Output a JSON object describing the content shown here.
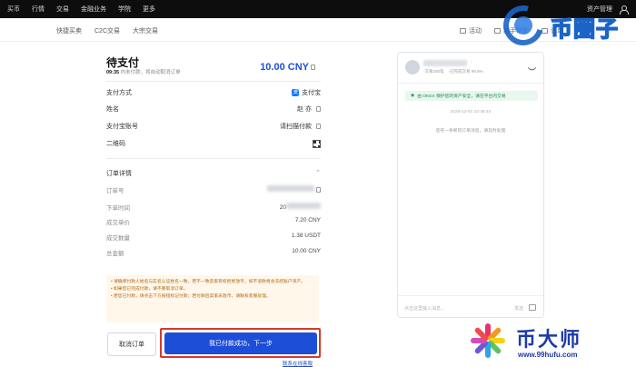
{
  "topnav": {
    "items": [
      "买币",
      "行情",
      "交易",
      "金融业务",
      "学院",
      "更多"
    ],
    "right_label": "资产管理"
  },
  "subnav": {
    "left": [
      "快捷买卖",
      "C2C交易",
      "大宗交易"
    ],
    "right": [
      "活动",
      "新手帮助",
      "订单"
    ]
  },
  "watermark_top": {
    "text": "币圈子",
    "color": "#1a64c8"
  },
  "order": {
    "status_title": "待支付",
    "countdown": "09:35",
    "countdown_suffix": "内未付款，将自动取消订单",
    "amount": "10.00 CNY",
    "rows": [
      {
        "label": "支付方式",
        "value": "支付宝"
      },
      {
        "label": "姓名",
        "value": "赵 亦"
      },
      {
        "label": "支付宝账号",
        "value": "请扫描付款"
      },
      {
        "label": "二维码",
        "value": ""
      }
    ],
    "details_title": "订单详情",
    "details": [
      {
        "label": "订单号",
        "value": ""
      },
      {
        "label": "下单时间",
        "value": "20"
      },
      {
        "label": "成交单价",
        "value": "7.20 CNY"
      },
      {
        "label": "成交数量",
        "value": "1.38 USDT"
      },
      {
        "label": "总金额",
        "value": "10.00 CNY"
      }
    ]
  },
  "notice": {
    "lines": [
      "• 请确保付款人姓名与实名认证姓名一致，若不一致卖家有权拒绝放币，如不退款将会冻结账户资产。",
      "• 如果您已完成付款，请不要取消订单。",
      "• 若您已付款，请点击下方按钮标记付款；若付款后卖家未放币，请联系客服处理。"
    ]
  },
  "buttons": {
    "cancel": "取消订单",
    "confirm": "我已付款成功，下一步",
    "contact": "联系在线客服"
  },
  "chat": {
    "nick_suffix": "·",
    "meta": [
      "·交易200笔",
      "·已完成交易 99.6%"
    ],
    "secure_text": "由 OKEX 保护您的资产安全，请在平台内交易",
    "timestamp": "2020-12-01 10:38:40",
    "system_msg": "您有一条新的订单消息，请及时处理",
    "input_placeholder": "点击这里输入消息...",
    "send_label": "发送"
  },
  "watermark_bottom": {
    "text": "币大师",
    "url": "www.99hufu.com",
    "color": "#1e3aa8"
  }
}
